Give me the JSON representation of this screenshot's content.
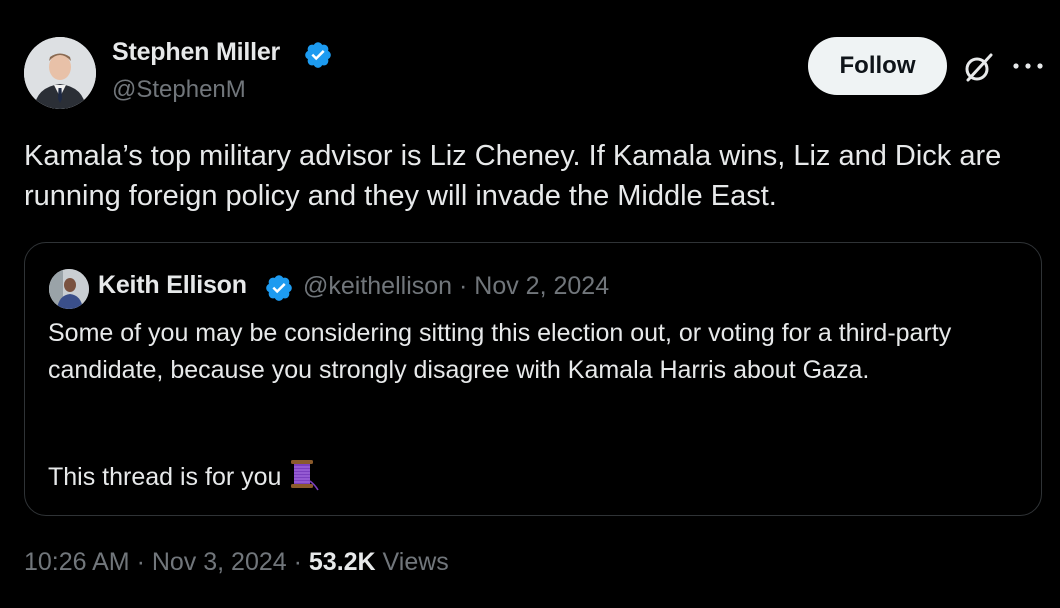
{
  "author": {
    "name": "Stephen Miller",
    "handle": "@StephenM",
    "verified": true
  },
  "header": {
    "follow_label": "Follow",
    "grok_icon": "grok-icon",
    "more_icon": "more-options-icon"
  },
  "tweet": {
    "text": "Kamala’s top military advisor is Liz Cheney. If Kamala wins, Liz and Dick are running foreign policy and they will invade the Middle East."
  },
  "quote": {
    "author_name": "Keith Ellison",
    "author_handle": "@keithellison",
    "separator": "·",
    "date": "Nov 2, 2024",
    "meta": "@keithellison · Nov 2, 2024",
    "text_1": "Some of you may be considering sitting this election out, or voting for a third-party candidate, because you strongly disagree with Kamala Harris about Gaza.",
    "text_2": "This thread is for you",
    "emoji": "spool-of-thread-icon"
  },
  "footer": {
    "time_date": "10:26 AM · Nov 3, 2024 · ",
    "views_count": "53.2K",
    "views_label": " Views"
  },
  "colors": {
    "background": "#000000",
    "text_primary": "#e7e9ea",
    "text_secondary": "#71767b",
    "verified_blue": "#1d9bf0",
    "follow_bg": "#eff3f4",
    "border": "#2f3336"
  }
}
